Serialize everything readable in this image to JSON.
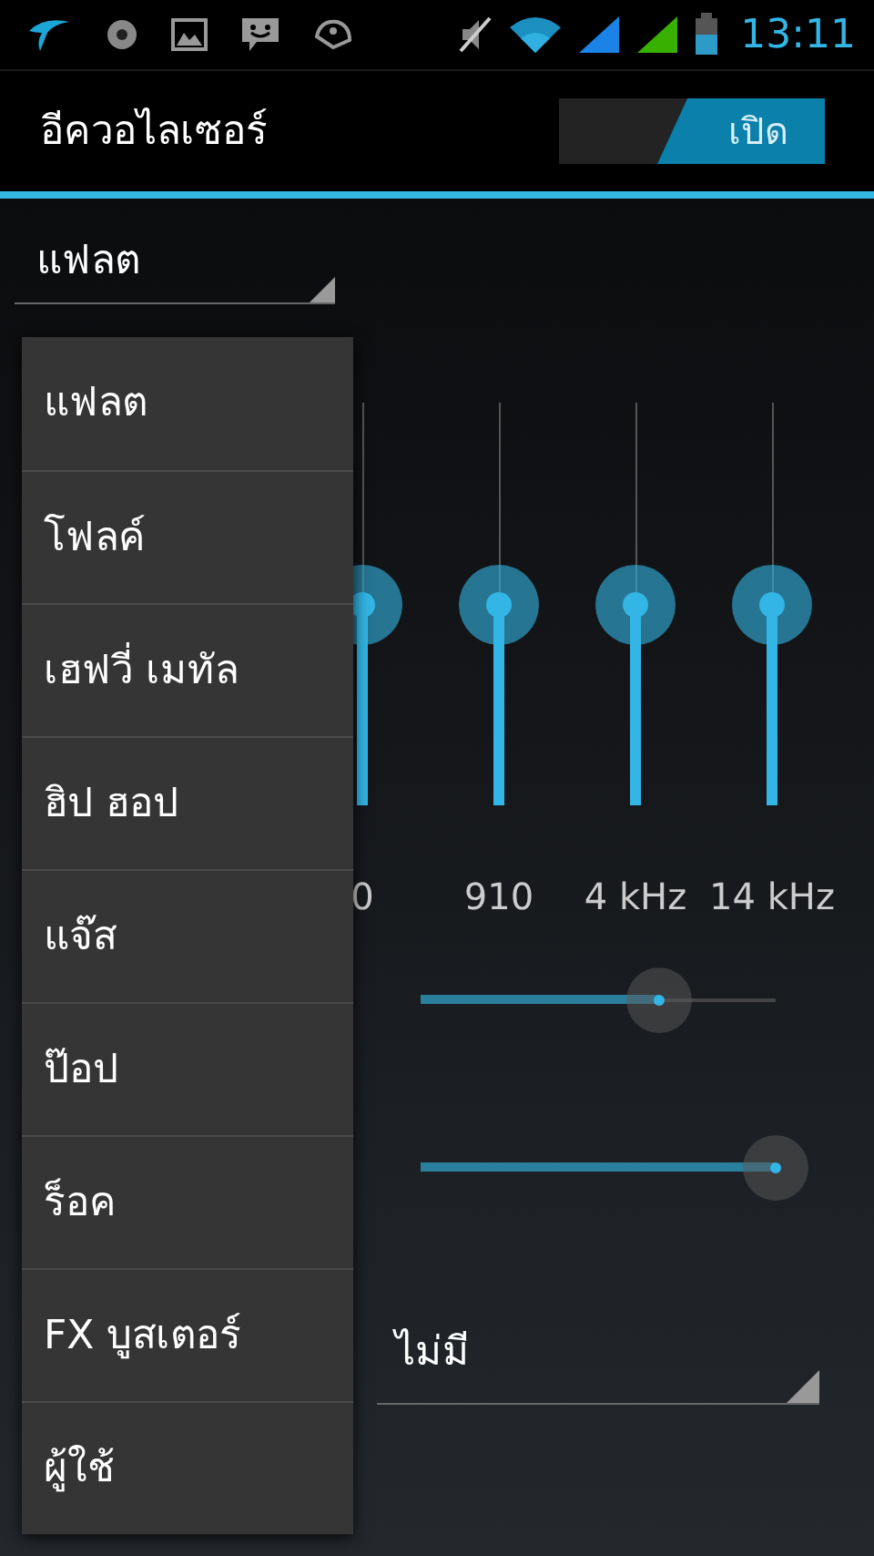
{
  "status_bar": {
    "time": "13:11"
  },
  "action_bar": {
    "title": "อีควอไลเซอร์",
    "switch": {
      "label": "เปิด",
      "on": true
    }
  },
  "preset_spinner": {
    "value": "แฟลต"
  },
  "bands": [
    {
      "label": "0",
      "level": 0.5
    },
    {
      "label": "910",
      "level": 0.5
    },
    {
      "label": "4 kHz",
      "level": 0.5
    },
    {
      "label": "14 kHz",
      "level": 0.5
    }
  ],
  "sliders": [
    {
      "level": 0.67
    },
    {
      "level": 1.0
    }
  ],
  "reverb_spinner": {
    "value": "ไม่มี"
  },
  "dropdown": {
    "items": [
      {
        "label": "แฟลต",
        "selected": false
      },
      {
        "label": "โฟลค์",
        "selected": false
      },
      {
        "label": "เฮฟวี่ เมทัล",
        "selected": false
      },
      {
        "label": "ฮิป ฮอป",
        "selected": false
      },
      {
        "label": "แจ๊ส",
        "selected": false
      },
      {
        "label": "ป๊อป",
        "selected": false
      },
      {
        "label": "ร็อค",
        "selected": false
      },
      {
        "label": "FX บูสเตอร์",
        "selected": false
      },
      {
        "label": "ผู้ใช้",
        "selected": false
      }
    ]
  }
}
